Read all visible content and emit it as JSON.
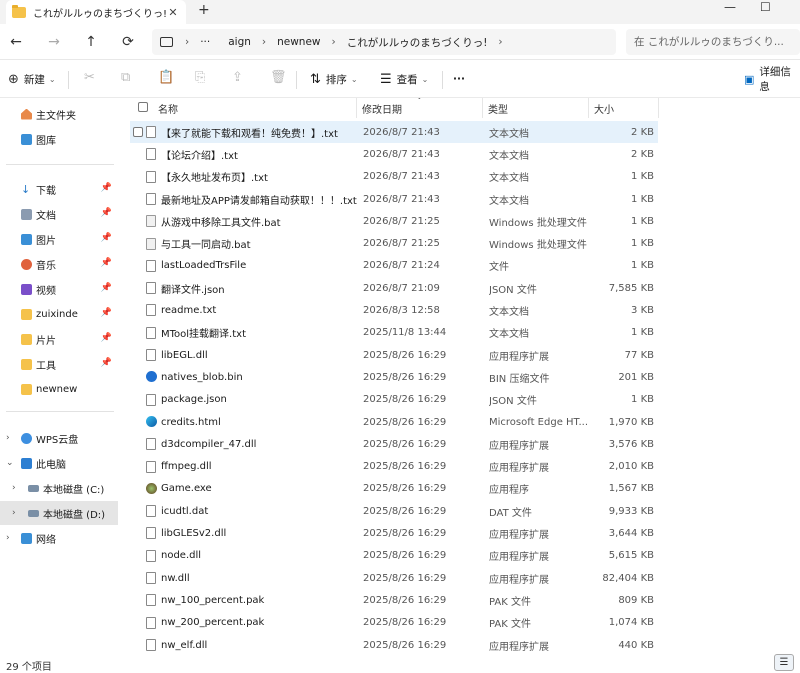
{
  "window": {
    "tab_title": "これがルルゥのまちづくりっ!",
    "tab_close": "✕",
    "tab_add": "+",
    "minimize": "—",
    "maximize": "☐"
  },
  "nav": {
    "back": "←",
    "forward": "→",
    "up": "↑",
    "refresh": "⟳",
    "expand": "›",
    "ellipsis": "···",
    "breadcrumb": [
      "aign",
      "newnew",
      "これがルルゥのまちづくりっ!"
    ],
    "search_placeholder": "在 これがルルゥのまちづくり..."
  },
  "toolbar": {
    "new_label": "新建",
    "sort_label": "排序",
    "view_label": "查看",
    "more_label": "···",
    "details_label": "详细信息"
  },
  "sidebar": {
    "quick": [
      {
        "label": "主文件夹",
        "icon": "home-icon",
        "pinned": false
      },
      {
        "label": "图库",
        "icon": "gallery-icon",
        "pinned": false
      }
    ],
    "pinned": [
      {
        "label": "下载",
        "icon": "download-icon",
        "pinned": true
      },
      {
        "label": "文档",
        "icon": "documents-icon",
        "pinned": true
      },
      {
        "label": "图片",
        "icon": "pictures-icon",
        "pinned": true
      },
      {
        "label": "音乐",
        "icon": "music-icon",
        "pinned": true
      },
      {
        "label": "视频",
        "icon": "video-icon",
        "pinned": true
      },
      {
        "label": "zuixinde",
        "icon": "folder-icon",
        "pinned": true
      },
      {
        "label": "片片",
        "icon": "folder-icon",
        "pinned": true
      },
      {
        "label": "工具",
        "icon": "folder-icon",
        "pinned": true
      },
      {
        "label": "newnew",
        "icon": "folder-icon",
        "pinned": false
      }
    ],
    "tree": [
      {
        "label": "WPS云盘",
        "icon": "cloud-icon",
        "expander": "›"
      },
      {
        "label": "此电脑",
        "icon": "pc-icon",
        "expander": "⌄"
      },
      {
        "label": "本地磁盘 (C:)",
        "icon": "drive-icon",
        "expander": "›"
      },
      {
        "label": "本地磁盘 (D:)",
        "icon": "drive-icon",
        "expander": "›",
        "selected": true
      },
      {
        "label": "网络",
        "icon": "network-icon",
        "expander": "›"
      }
    ]
  },
  "columns": {
    "name": "名称",
    "date": "修改日期",
    "type": "类型",
    "size": "大小"
  },
  "files": [
    {
      "name": "【来了就能下载和观看！纯免费！】.txt",
      "date": "2026/8/7 21:43",
      "type": "文本文档",
      "size": "2 KB",
      "icon": "text-file-icon",
      "highlight": true
    },
    {
      "name": "【论坛介绍】.txt",
      "date": "2026/8/7 21:43",
      "type": "文本文档",
      "size": "2 KB",
      "icon": "text-file-icon"
    },
    {
      "name": "【永久地址发布页】.txt",
      "date": "2026/8/7 21:43",
      "type": "文本文档",
      "size": "1 KB",
      "icon": "text-file-icon"
    },
    {
      "name": "最新地址及APP请发邮箱自动获取！！！.txt",
      "date": "2026/8/7 21:43",
      "type": "文本文档",
      "size": "1 KB",
      "icon": "text-file-icon"
    },
    {
      "name": "从游戏中移除工具文件.bat",
      "date": "2026/8/7 21:25",
      "type": "Windows 批处理文件",
      "size": "1 KB",
      "icon": "batch-file-icon"
    },
    {
      "name": "与工具一同启动.bat",
      "date": "2026/8/7 21:25",
      "type": "Windows 批处理文件",
      "size": "1 KB",
      "icon": "batch-file-icon"
    },
    {
      "name": "lastLoadedTrsFile",
      "date": "2026/8/7 21:24",
      "type": "文件",
      "size": "1 KB",
      "icon": "file-icon"
    },
    {
      "name": "翻译文件.json",
      "date": "2026/8/7 21:09",
      "type": "JSON 文件",
      "size": "7,585 KB",
      "icon": "file-icon"
    },
    {
      "name": "readme.txt",
      "date": "2026/8/3 12:58",
      "type": "文本文档",
      "size": "3 KB",
      "icon": "text-file-icon"
    },
    {
      "name": "MTool挂载翻译.txt",
      "date": "2025/11/8 13:44",
      "type": "文本文档",
      "size": "1 KB",
      "icon": "text-file-icon"
    },
    {
      "name": "libEGL.dll",
      "date": "2025/8/26 16:29",
      "type": "应用程序扩展",
      "size": "77 KB",
      "icon": "dll-file-icon"
    },
    {
      "name": "natives_blob.bin",
      "date": "2025/8/26 16:29",
      "type": "BIN 压缩文件",
      "size": "201 KB",
      "icon": "bin-file-icon"
    },
    {
      "name": "package.json",
      "date": "2025/8/26 16:29",
      "type": "JSON 文件",
      "size": "1 KB",
      "icon": "file-icon"
    },
    {
      "name": "credits.html",
      "date": "2025/8/26 16:29",
      "type": "Microsoft Edge HT...",
      "size": "1,970 KB",
      "icon": "edge-html-icon"
    },
    {
      "name": "d3dcompiler_47.dll",
      "date": "2025/8/26 16:29",
      "type": "应用程序扩展",
      "size": "3,576 KB",
      "icon": "dll-file-icon"
    },
    {
      "name": "ffmpeg.dll",
      "date": "2025/8/26 16:29",
      "type": "应用程序扩展",
      "size": "2,010 KB",
      "icon": "dll-file-icon"
    },
    {
      "name": "Game.exe",
      "date": "2025/8/26 16:29",
      "type": "应用程序",
      "size": "1,567 KB",
      "icon": "exe-file-icon"
    },
    {
      "name": "icudtl.dat",
      "date": "2025/8/26 16:29",
      "type": "DAT 文件",
      "size": "9,933 KB",
      "icon": "file-icon"
    },
    {
      "name": "libGLESv2.dll",
      "date": "2025/8/26 16:29",
      "type": "应用程序扩展",
      "size": "3,644 KB",
      "icon": "dll-file-icon"
    },
    {
      "name": "node.dll",
      "date": "2025/8/26 16:29",
      "type": "应用程序扩展",
      "size": "5,615 KB",
      "icon": "dll-file-icon"
    },
    {
      "name": "nw.dll",
      "date": "2025/8/26 16:29",
      "type": "应用程序扩展",
      "size": "82,404 KB",
      "icon": "dll-file-icon"
    },
    {
      "name": "nw_100_percent.pak",
      "date": "2025/8/26 16:29",
      "type": "PAK 文件",
      "size": "809 KB",
      "icon": "file-icon"
    },
    {
      "name": "nw_200_percent.pak",
      "date": "2025/8/26 16:29",
      "type": "PAK 文件",
      "size": "1,074 KB",
      "icon": "file-icon"
    },
    {
      "name": "nw_elf.dll",
      "date": "2025/8/26 16:29",
      "type": "应用程序扩展",
      "size": "440 KB",
      "icon": "dll-file-icon"
    }
  ],
  "status": {
    "item_count": "29 个项目"
  },
  "colors": {
    "accent": "#0067c0",
    "highlight_row": "#e5f1fb",
    "folder": "#f5c24a",
    "selected_nav": "#e5e5e5"
  }
}
